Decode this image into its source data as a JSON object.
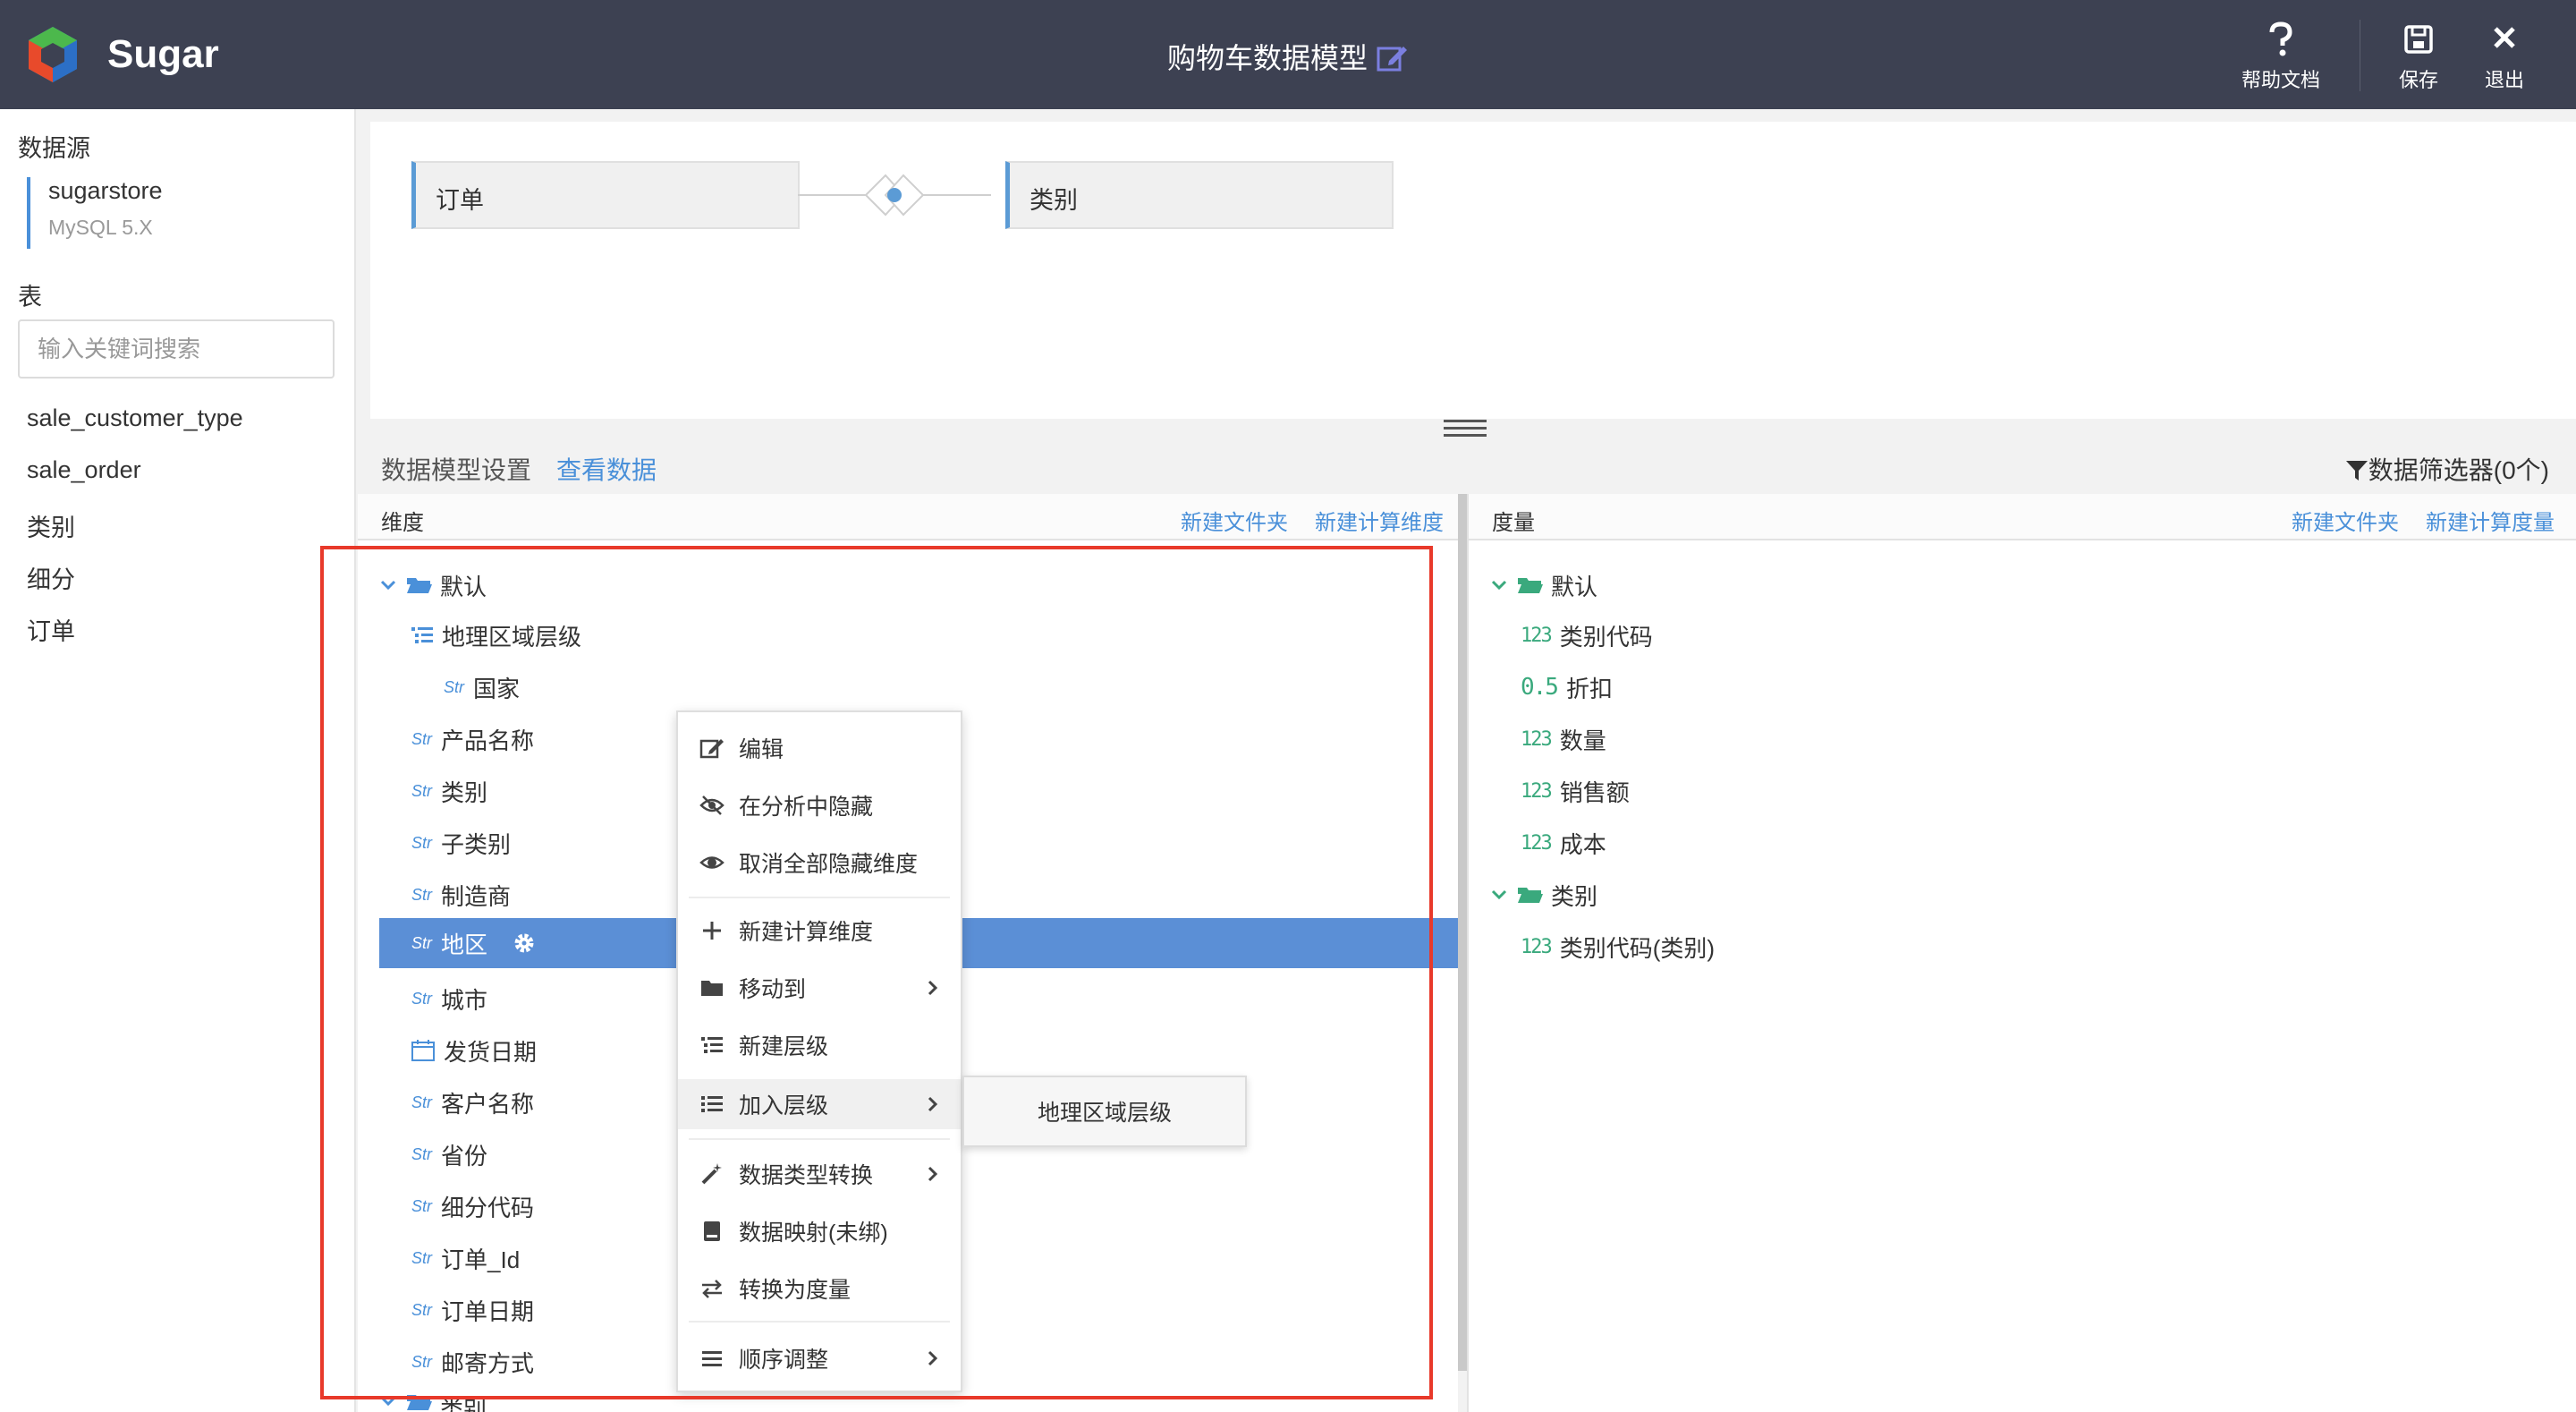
{
  "header": {
    "brand": "Sugar",
    "title": "购物车数据模型",
    "help_label": "帮助文档",
    "save_label": "保存",
    "exit_label": "退出"
  },
  "sidebar": {
    "datasource_label": "数据源",
    "datasource_name": "sugarstore",
    "datasource_type": "MySQL 5.X",
    "tables_label": "表",
    "search_placeholder": "输入关键词搜索",
    "tables": [
      "sale_customer_type",
      "sale_order",
      "类别",
      "细分",
      "订单"
    ]
  },
  "canvas": {
    "left_node": "订单",
    "right_node": "类别"
  },
  "tabs": {
    "settings": "数据模型设置",
    "view_data": "查看数据",
    "filter": "数据筛选器(0个)"
  },
  "dimensions": {
    "title": "维度",
    "new_folder": "新建文件夹",
    "new_calc": "新建计算维度",
    "folder_default": "默认",
    "hierarchy": "地理区域层级",
    "hierarchy_child": "国家",
    "items": [
      "产品名称",
      "类别",
      "子类别",
      "制造商",
      "地区",
      "城市",
      "发货日期",
      "客户名称",
      "省份",
      "细分代码",
      "订单_Id",
      "订单日期",
      "邮寄方式"
    ],
    "next_folder": "类别",
    "str_tag": "Str"
  },
  "measures": {
    "title": "度量",
    "new_folder": "新建文件夹",
    "new_calc": "新建计算度量",
    "folder_default": "默认",
    "items": [
      {
        "tag": "123",
        "label": "类别代码"
      },
      {
        "tag": "0.5",
        "label": "折扣"
      },
      {
        "tag": "123",
        "label": "数量"
      },
      {
        "tag": "123",
        "label": "销售额"
      },
      {
        "tag": "123",
        "label": "成本"
      }
    ],
    "folder_category": "类别",
    "category_items": [
      {
        "tag": "123",
        "label": "类别代码(类别)"
      }
    ]
  },
  "context_menu": {
    "items": [
      "编辑",
      "在分析中隐藏",
      "取消全部隐藏维度",
      "新建计算维度",
      "移动到",
      "新建层级",
      "加入层级",
      "数据类型转换",
      "数据映射(未绑)",
      "转换为度量",
      "顺序调整"
    ],
    "submenu_item": "地理区域层级"
  },
  "colors": {
    "header_bg": "#3d4152",
    "accent": "#4a90d9",
    "selected_row": "#5b8fd6",
    "highlight_box": "#e8392a"
  }
}
